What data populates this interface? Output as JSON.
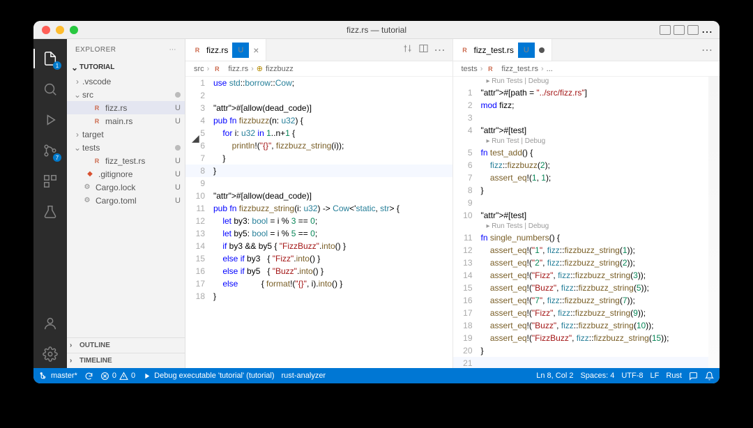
{
  "window_title": "fizz.rs — tutorial",
  "explorer": {
    "title": "EXPLORER",
    "root": "TUTORIAL",
    "nodes": [
      {
        "label": ".vscode",
        "type": "folder",
        "depth": 0,
        "expanded": false
      },
      {
        "label": "src",
        "type": "folder",
        "depth": 0,
        "expanded": true,
        "dot": true
      },
      {
        "label": "fizz.rs",
        "type": "rust",
        "depth": 1,
        "git": "U",
        "selected": true
      },
      {
        "label": "main.rs",
        "type": "rust",
        "depth": 1,
        "git": "U"
      },
      {
        "label": "target",
        "type": "folder",
        "depth": 0,
        "expanded": false
      },
      {
        "label": "tests",
        "type": "folder",
        "depth": 0,
        "expanded": true,
        "dot": true
      },
      {
        "label": "fizz_test.rs",
        "type": "rust",
        "depth": 1,
        "git": "U"
      },
      {
        "label": ".gitignore",
        "type": "git",
        "depth": 0,
        "git": "U"
      },
      {
        "label": "Cargo.lock",
        "type": "toml",
        "depth": 0,
        "git": "U"
      },
      {
        "label": "Cargo.toml",
        "type": "toml",
        "depth": 0,
        "git": "U"
      }
    ],
    "outline": "OUTLINE",
    "timeline": "TIMELINE"
  },
  "scm_badge": 7,
  "left_pane": {
    "tab_label": "fizz.rs",
    "tab_status": "U",
    "breadcrumbs": [
      "src",
      "fizz.rs",
      "fizzbuzz"
    ],
    "code": [
      "use std::borrow::Cow;",
      "",
      "#[allow(dead_code)]",
      "pub fn fizzbuzz(n: u32) {",
      "    for i: u32 in 1..n+1 {",
      "        println!(\"{}\", fizzbuzz_string(i));",
      "    }",
      "}",
      "",
      "#[allow(dead_code)]",
      "pub fn fizzbuzz_string(i: u32) -> Cow<'static, str> {",
      "    let by3: bool = i % 3 == 0;",
      "    let by5: bool = i % 5 == 0;",
      "    if by3 && by5 { \"FizzBuzz\".into() }",
      "    else if by3   { \"Fizz\".into() }",
      "    else if by5   { \"Buzz\".into() }",
      "    else          { format!(\"{}\", i).into() }",
      "}"
    ]
  },
  "right_pane": {
    "tab_label": "fizz_test.rs",
    "tab_status": "U",
    "breadcrumbs": [
      "tests",
      "fizz_test.rs",
      "..."
    ],
    "codelens1": "▸ Run Tests | Debug",
    "codelens2": "▸ Run Test | Debug",
    "codelens3": "▸ Run Tests | Debug",
    "code_top": [
      "#[path = \"../src/fizz.rs\"]",
      "mod fizz;",
      "",
      "#[test]"
    ],
    "code_mid": [
      "fn test_add() {",
      "    fizz::fizzbuzz(2);",
      "    assert_eq!(1, 1);",
      "}",
      "",
      "#[test]"
    ],
    "code_bot": [
      "fn single_numbers() {",
      "    assert_eq!(\"1\", fizz::fizzbuzz_string(1));",
      "    assert_eq!(\"2\", fizz::fizzbuzz_string(2));",
      "    assert_eq!(\"Fizz\", fizz::fizzbuzz_string(3));",
      "    assert_eq!(\"Buzz\", fizz::fizzbuzz_string(5));",
      "    assert_eq!(\"7\", fizz::fizzbuzz_string(7));",
      "    assert_eq!(\"Fizz\", fizz::fizzbuzz_string(9));",
      "    assert_eq!(\"Buzz\", fizz::fizzbuzz_string(10));",
      "    assert_eq!(\"FizzBuzz\", fizz::fizzbuzz_string(15));",
      "}",
      ""
    ]
  },
  "status": {
    "branch": "master*",
    "errors": "0",
    "warnings": "0",
    "debug": "Debug executable 'tutorial' (tutorial)",
    "analyzer": "rust-analyzer",
    "pos": "Ln 8, Col 2",
    "spaces": "Spaces: 4",
    "enc": "UTF-8",
    "eol": "LF",
    "lang": "Rust"
  }
}
